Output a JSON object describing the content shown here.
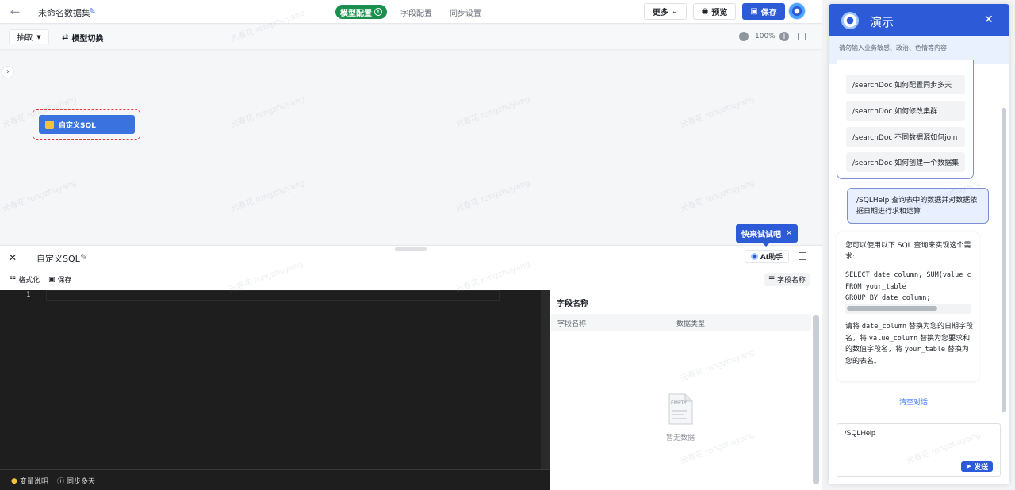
{
  "header": {
    "dataset_title": "未命名数据集",
    "tabs": [
      "模型配置",
      "字段配置",
      "同步设置"
    ],
    "more_label": "更多",
    "preview_label": "预览",
    "save_label": "保存"
  },
  "toolbar": {
    "extract_label": "抽取",
    "switch_model_label": "模型切换",
    "zoom_level": "100%"
  },
  "canvas": {
    "node_label": "自定义SQL",
    "watermark": "元春花 rongzhuyang"
  },
  "sql_panel": {
    "title": "自定义SQL",
    "tip_label": "快来试试吧",
    "ai_label": "AI助手",
    "format_label": "格式化",
    "save_label": "保存",
    "field_name_button": "字段名称",
    "line_number": "1",
    "variable_desc": "变量说明",
    "sync_days": "同步多天"
  },
  "field_panel": {
    "title": "字段名称",
    "columns": [
      "字段名称",
      "数据类型"
    ],
    "empty_text": "暂无数据",
    "empty_badge": "EMPTY"
  },
  "chat": {
    "title": "演示",
    "notice": "请勿输入业务敏感、政治、色情等内容",
    "suggestions": [
      "/searchDoc 如何配置同步多天",
      "/searchDoc 如何修改集群",
      "/searchDoc 不同数据源如何join",
      "/searchDoc 如何创建一个数据集"
    ],
    "user_message": "/SQLHelp 查询表中的数据并对数据依据日期进行求和运算",
    "bot_intro": "您可以使用以下 SQL 查询来实现这个需求:",
    "bot_code": "SELECT date_column, SUM(value_column)\nFROM your_table\nGROUP BY date_column;",
    "bot_outro_parts": [
      "请将 ",
      "date_column",
      " 替换为您的日期字段名，将 ",
      "value_column",
      " 替换为您要求和的数值字段名，将 ",
      "your_table",
      " 替换为您的表名。"
    ],
    "clear_label": "清空对话",
    "input_value": "/SQLHelp",
    "send_label": "发送"
  },
  "colors": {
    "primary": "#2d5bd8",
    "tab_active": "#1a8f4e",
    "node_border": "#e03a3a"
  }
}
